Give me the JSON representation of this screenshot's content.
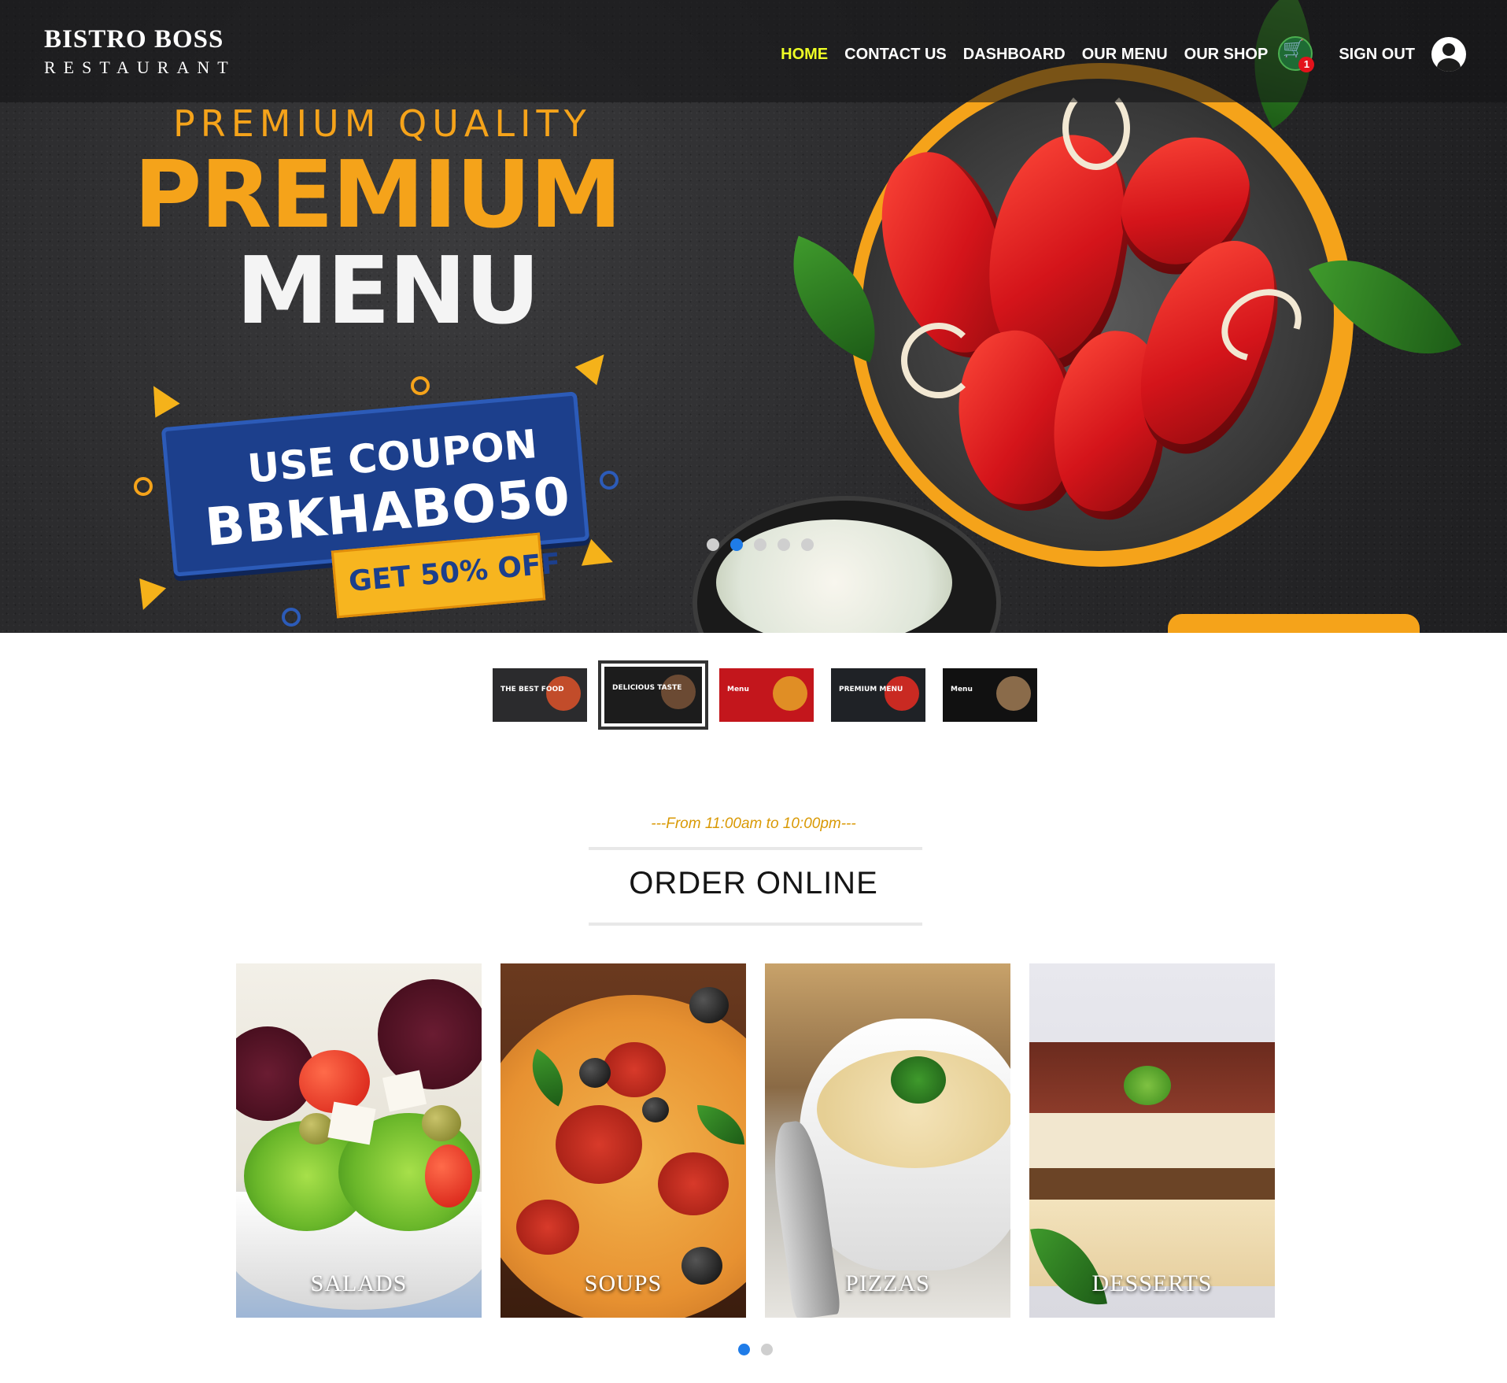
{
  "brand": {
    "title": "BISTRO BOSS",
    "subtitle": "Restaurant"
  },
  "nav": {
    "links": [
      "HOME",
      "CONTACT US",
      "DASHBOARD",
      "OUR MENU",
      "OUR SHOP"
    ],
    "active": "HOME",
    "cart_count": "1",
    "sign_out": "SIGN OUT"
  },
  "hero": {
    "kicker": "PREMIUM QUALITY",
    "headline_1": "PREMIUM",
    "headline_2": "MENU",
    "coupon_line_1": "USE COUPON",
    "coupon_code": "BBKHABO50",
    "coupon_offer": "GET 50% OFF",
    "slide_count": 5,
    "active_slide": 2
  },
  "thumbnails": [
    {
      "label": "THE BEST FOOD",
      "bg": "#2b2b2d",
      "plate": "#c24c2a"
    },
    {
      "label": "DELICIOUS TASTE",
      "bg": "#1c1c1c",
      "plate": "#6b4a33"
    },
    {
      "label": "Menu",
      "bg": "#c3161c",
      "plate": "#e08e25"
    },
    {
      "label": "PREMIUM MENU",
      "bg": "#1f2226",
      "plate": "#c92a22"
    },
    {
      "label": "Menu",
      "bg": "#111111",
      "plate": "#8a6b4a"
    }
  ],
  "order": {
    "subtitle": "---From 11:00am to 10:00pm---",
    "heading": "ORDER ONLINE",
    "categories": [
      "Salads",
      "Soups",
      "pizzas",
      "desserts"
    ],
    "page_count": 2,
    "active_page": 1
  },
  "colors": {
    "accent_yellow": "#eeff25",
    "gold": "#d99904",
    "dot_active": "#1f7ce8"
  }
}
